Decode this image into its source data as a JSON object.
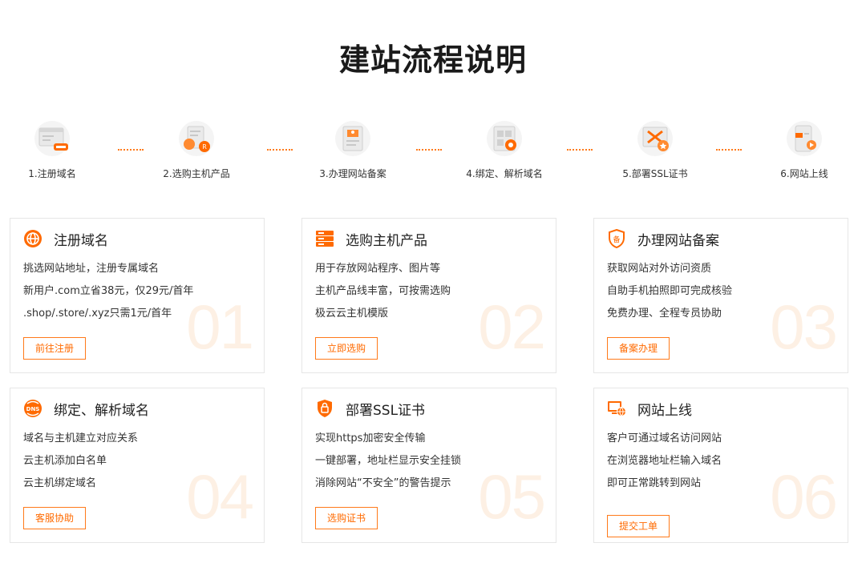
{
  "page_title": "建站流程说明",
  "colors": {
    "accent": "#ff6a00",
    "border": "#e6e6e6",
    "watermark": "#fdf0e4"
  },
  "steps": [
    {
      "label": "1.注册域名",
      "icon": "browser-domain-icon"
    },
    {
      "label": "2.选购主机产品",
      "icon": "host-product-icon"
    },
    {
      "label": "3.办理网站备案",
      "icon": "record-document-icon"
    },
    {
      "label": "4.绑定、解析域名",
      "icon": "bind-resolve-icon"
    },
    {
      "label": "5.部署SSL证书",
      "icon": "ssl-certificate-icon"
    },
    {
      "label": "6.网站上线",
      "icon": "site-online-icon"
    }
  ],
  "cards": [
    {
      "title": "注册域名",
      "icon": "globe-icon",
      "num": "01",
      "lines": [
        "挑选网站地址，注册专属域名",
        "新用户.com立省38元，仅29元/首年",
        ".shop/.store/.xyz只需1元/首年"
      ],
      "button": "前往注册"
    },
    {
      "title": "选购主机产品",
      "icon": "server-icon",
      "num": "02",
      "lines": [
        "用于存放网站程序、图片等",
        "主机产品线丰富，可按需选购",
        "极云云主机模版"
      ],
      "button": "立即选购"
    },
    {
      "title": "办理网站备案",
      "icon": "record-shield-icon",
      "num": "03",
      "lines": [
        "获取网站对外访问资质",
        "自助手机拍照即可完成核验",
        "免费办理、全程专员协助"
      ],
      "button": "备案办理"
    },
    {
      "title": "绑定、解析域名",
      "icon": "dns-icon",
      "num": "04",
      "lines": [
        "域名与主机建立对应关系",
        "云主机添加白名单",
        "云主机绑定域名"
      ],
      "button": "客服协助"
    },
    {
      "title": "部署SSL证书",
      "icon": "ssl-shield-icon",
      "num": "05",
      "lines": [
        "实现https加密安全传输",
        "一键部署，地址栏显示安全挂锁",
        "消除网站“不安全”的警告提示"
      ],
      "button": "选购证书"
    },
    {
      "title": "网站上线",
      "icon": "monitor-globe-icon",
      "num": "06",
      "lines": [
        "客户可通过域名访问网站",
        "在浏览器地址栏输入域名",
        "即可正常跳转到网站"
      ],
      "button": "提交工单"
    }
  ]
}
